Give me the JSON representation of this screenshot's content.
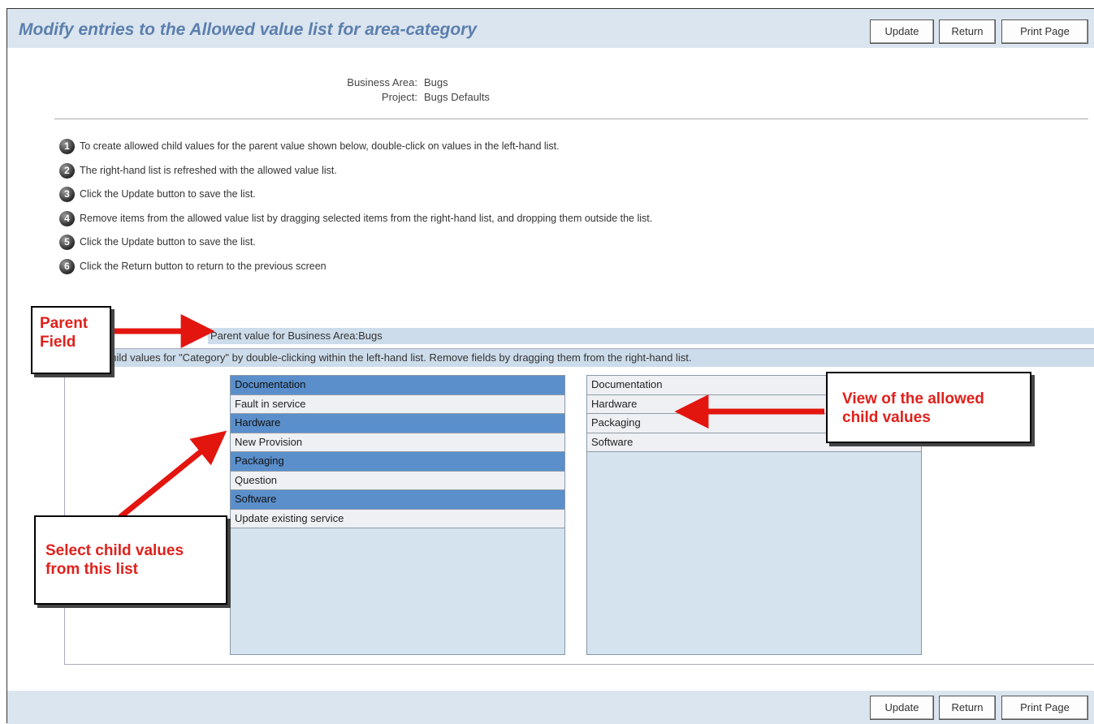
{
  "header": {
    "title": "Modify entries to the Allowed value list for area-category",
    "buttons": {
      "update": "Update",
      "return": "Return",
      "print": "Print Page"
    }
  },
  "meta": {
    "business_area_label": "Business Area:",
    "business_area_value": "Bugs",
    "project_label": "Project:",
    "project_value": "Bugs Defaults"
  },
  "steps": [
    {
      "num": "1",
      "text": "To create allowed child values for the parent value shown below, double-click on values in the left-hand list."
    },
    {
      "num": "2",
      "text": "The right-hand list is refreshed with the allowed value list."
    },
    {
      "num": "3",
      "text": "Click the Update button to save the list."
    },
    {
      "num": "4",
      "text": "Remove items from the allowed value list by dragging selected items from the right-hand list, and dropping them outside the list."
    },
    {
      "num": "5",
      "text": "Click the Update button to save the list."
    },
    {
      "num": "6",
      "text": "Click the Return button to return to the previous screen"
    }
  ],
  "parent_value": "Parent value for Business Area:Bugs",
  "panel_header": "Select child values for \"Category\" by double-clicking within the left-hand list. Remove fields by dragging them from the right-hand list.",
  "left_list": [
    {
      "label": "Documentation",
      "selected": true
    },
    {
      "label": "Fault in service",
      "selected": false
    },
    {
      "label": "Hardware",
      "selected": true
    },
    {
      "label": "New Provision",
      "selected": false
    },
    {
      "label": "Packaging",
      "selected": true
    },
    {
      "label": "Question",
      "selected": false
    },
    {
      "label": "Software",
      "selected": true
    },
    {
      "label": "Update existing service",
      "selected": false
    }
  ],
  "right_list": [
    "Documentation",
    "Hardware",
    "Packaging",
    "Software"
  ],
  "callouts": {
    "parent_field": "Parent Field",
    "allowed_child": "View of the allowed child values",
    "select_child": "Select child values from this list"
  },
  "footer": {
    "buttons": {
      "update": "Update",
      "return": "Return",
      "print": "Print Page"
    }
  },
  "colors": {
    "title": "#5b7fad",
    "bar": "#dbe5ef",
    "selected_item": "#5a8fcb",
    "callout_text": "#e0201b",
    "arrow": "#e3150f"
  }
}
